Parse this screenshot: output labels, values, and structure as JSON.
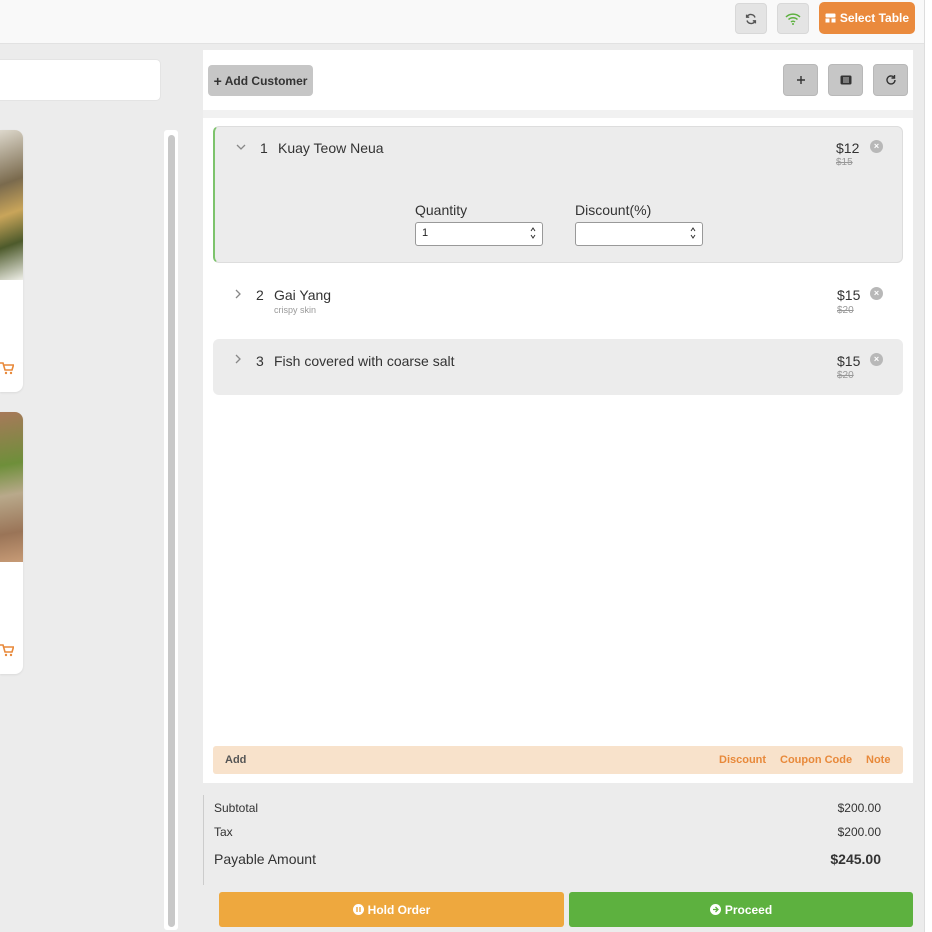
{
  "header": {
    "sync_icon": "sync-icon",
    "wifi_icon": "wifi-icon",
    "select_table_label": "Select Table",
    "colors": {
      "accent": "#ea8a3d",
      "wifi": "#5db13f"
    }
  },
  "cart": {
    "add_customer_label": "Add Customer",
    "items": [
      {
        "index": "1",
        "name": "Kuay Teow Neua",
        "note": "",
        "price": "$12",
        "old_price": "$15",
        "expanded": true,
        "quantity": "1",
        "discount": ""
      },
      {
        "index": "2",
        "name": "Gai Yang",
        "note": "crispy skin",
        "price": "$15",
        "old_price": "$20",
        "expanded": false
      },
      {
        "index": "3",
        "name": "Fish covered with coarse salt",
        "note": "",
        "price": "$15",
        "old_price": "$20",
        "expanded": false
      }
    ],
    "quantity_label": "Quantity",
    "discount_label": "Discount(%)",
    "actions": {
      "add": "Add",
      "discount": "Discount",
      "coupon": "Coupon Code",
      "note": "Note"
    }
  },
  "totals": {
    "subtotal_label": "Subtotal",
    "subtotal": "$200.00",
    "tax_label": "Tax",
    "tax": "$200.00",
    "payable_label": "Payable Amount",
    "payable": "$245.00"
  },
  "buttons": {
    "hold": "Hold Order",
    "proceed": "Proceed",
    "colors": {
      "hold": "#eea83e",
      "proceed": "#5db13f"
    }
  }
}
